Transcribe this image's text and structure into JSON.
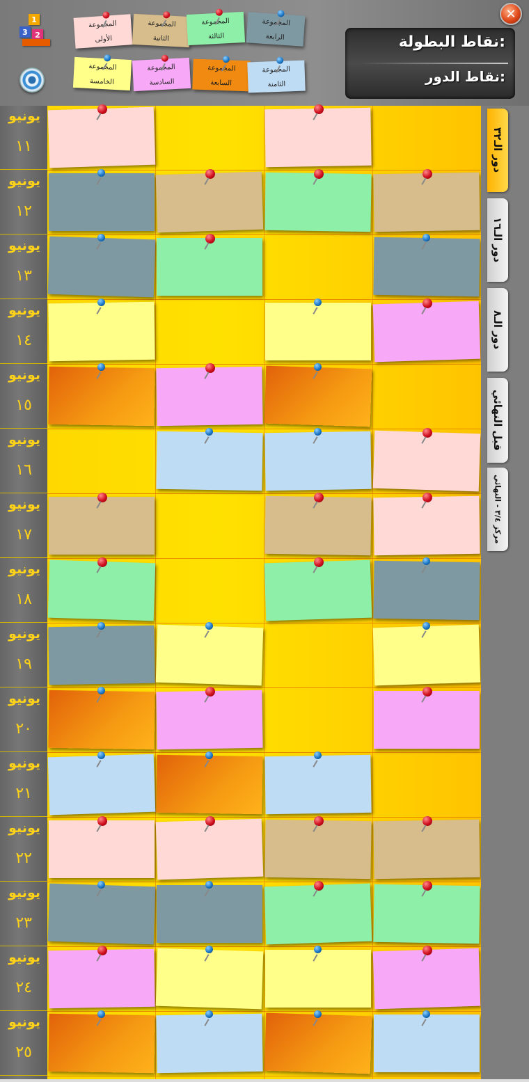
{
  "window": {
    "close_icon": "close-icon",
    "close_glyph": "✕"
  },
  "logo": {
    "icon": "podium-cubes-icon",
    "digits": [
      "3",
      "1",
      "2"
    ]
  },
  "speaker": {
    "icon": "speaker-icon"
  },
  "legend": [
    {
      "label": "المجموعة الأولى",
      "color": "#ffd9d6",
      "pin": "red"
    },
    {
      "label": "المجموعة الثانية",
      "color": "#d7bd8c",
      "pin": "red"
    },
    {
      "label": "المجموعة الثالثة",
      "color": "#8ef0a8",
      "pin": "red"
    },
    {
      "label": "المجموعة الرابعة",
      "color": "#7f99a3",
      "pin": "blue"
    },
    {
      "label": "المجموعة الخامسة",
      "color": "#ffff8a",
      "pin": "blue"
    },
    {
      "label": "المجموعة السادسة",
      "color": "#f7a9f7",
      "pin": "red"
    },
    {
      "label": "المجموعة السابعة",
      "color": "#f08a10",
      "pin": "blue"
    },
    {
      "label": "المجموعة الثامنة",
      "color": "#bfdcf5",
      "pin": "blue"
    }
  ],
  "points": {
    "tournament": "نقاط البطولة:",
    "round": "نقاط الدور:"
  },
  "colors": {
    "A": "#ffd9d6",
    "B": "#d7bd8c",
    "C": "#8ef0a8",
    "D": "#7f99a3",
    "E": "#ffff8a",
    "F": "#f7a9f7",
    "G": "#f08a10",
    "H": "#bfdcf5"
  },
  "days": [
    {
      "month": "يونيو",
      "day": "١١",
      "cells": [
        "A",
        "",
        "A",
        ""
      ],
      "pins": [
        "red",
        "",
        "red",
        ""
      ]
    },
    {
      "month": "يونيو",
      "day": "١٢",
      "cells": [
        "D",
        "B",
        "C",
        "B"
      ],
      "pins": [
        "blue",
        "red",
        "red",
        "red"
      ]
    },
    {
      "month": "يونيو",
      "day": "١٣",
      "cells": [
        "D",
        "C",
        "",
        "D"
      ],
      "pins": [
        "blue",
        "red",
        "",
        "blue"
      ]
    },
    {
      "month": "يونيو",
      "day": "١٤",
      "cells": [
        "E",
        "",
        "E",
        "F"
      ],
      "pins": [
        "blue",
        "",
        "blue",
        "red"
      ]
    },
    {
      "month": "يونيو",
      "day": "١٥",
      "cells": [
        "G",
        "F",
        "G",
        ""
      ],
      "pins": [
        "blue",
        "red",
        "blue",
        ""
      ]
    },
    {
      "month": "يونيو",
      "day": "١٦",
      "cells": [
        "",
        "H",
        "H",
        "A"
      ],
      "pins": [
        "",
        "blue",
        "blue",
        "red"
      ]
    },
    {
      "month": "يونيو",
      "day": "١٧",
      "cells": [
        "B",
        "",
        "B",
        "A"
      ],
      "pins": [
        "red",
        "",
        "red",
        "red"
      ]
    },
    {
      "month": "يونيو",
      "day": "١٨",
      "cells": [
        "C",
        "",
        "C",
        "D"
      ],
      "pins": [
        "red",
        "",
        "red",
        "blue"
      ]
    },
    {
      "month": "يونيو",
      "day": "١٩",
      "cells": [
        "D",
        "E",
        "",
        "E"
      ],
      "pins": [
        "blue",
        "blue",
        "",
        "blue"
      ]
    },
    {
      "month": "يونيو",
      "day": "٢٠",
      "cells": [
        "G",
        "F",
        "",
        "F"
      ],
      "pins": [
        "blue",
        "red",
        "",
        "red"
      ]
    },
    {
      "month": "يونيو",
      "day": "٢١",
      "cells": [
        "H",
        "G",
        "H",
        ""
      ],
      "pins": [
        "blue",
        "blue",
        "blue",
        ""
      ]
    },
    {
      "month": "يونيو",
      "day": "٢٢",
      "cells": [
        "A",
        "A",
        "B",
        "B"
      ],
      "pins": [
        "red",
        "red",
        "red",
        "red"
      ]
    },
    {
      "month": "يونيو",
      "day": "٢٣",
      "cells": [
        "D",
        "D",
        "C",
        "C"
      ],
      "pins": [
        "blue",
        "blue",
        "red",
        "red"
      ]
    },
    {
      "month": "يونيو",
      "day": "٢٤",
      "cells": [
        "F",
        "E",
        "E",
        "F"
      ],
      "pins": [
        "red",
        "blue",
        "blue",
        "red"
      ]
    },
    {
      "month": "يونيو",
      "day": "٢٥",
      "cells": [
        "G",
        "H",
        "G",
        "H"
      ],
      "pins": [
        "blue",
        "blue",
        "blue",
        "blue"
      ]
    }
  ],
  "tabs": [
    {
      "label": "دور الـ٣٢",
      "active": true
    },
    {
      "label": "دور الـ١٦",
      "active": false
    },
    {
      "label": "دور الـ٨",
      "active": false
    },
    {
      "label": "قبل النهائي",
      "active": false
    },
    {
      "label": "مركز ٣/٤  -  النهائي",
      "active": false
    }
  ]
}
